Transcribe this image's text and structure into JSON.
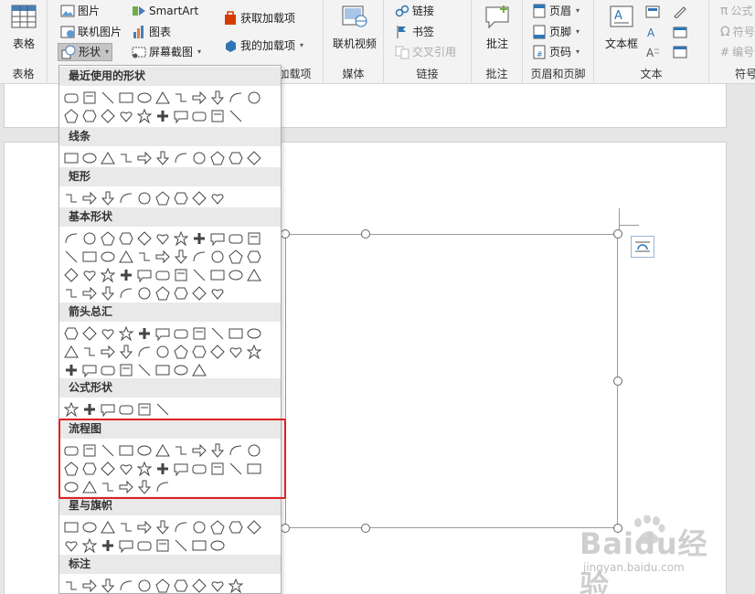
{
  "ribbon": {
    "tables": {
      "label": "表格",
      "group": "表格"
    },
    "illustrations": {
      "pictures": "图片",
      "online_pictures": "联机图片",
      "shapes": "形状",
      "smartart": "SmartArt",
      "chart": "图表",
      "screenshot": "屏幕截图"
    },
    "addins": {
      "get": "获取加载项",
      "mine": "我的加载项",
      "group": "加载项"
    },
    "media": {
      "online_video": "联机视频",
      "group": "媒体"
    },
    "links": {
      "link": "链接",
      "bookmark": "书签",
      "cross_ref": "交叉引用",
      "group": "链接"
    },
    "comments": {
      "comment": "批注",
      "group": "批注"
    },
    "header_footer": {
      "header": "页眉",
      "footer": "页脚",
      "page_number": "页码",
      "group": "页眉和页脚"
    },
    "text": {
      "textbox": "文本框",
      "group": "文本"
    },
    "symbols": {
      "equation": "公式",
      "symbol": "符号",
      "numbering": "编号",
      "group": "符号"
    }
  },
  "dropdown": {
    "sections": [
      {
        "title": "最近使用的形状",
        "count": 21
      },
      {
        "title": "线条",
        "count": 12
      },
      {
        "title": "矩形",
        "count": 9
      },
      {
        "title": "基本形状",
        "count": 42
      },
      {
        "title": "箭头总汇",
        "count": 30
      },
      {
        "title": "公式形状",
        "count": 6
      },
      {
        "title": "流程图",
        "count": 28
      },
      {
        "title": "星与旗帜",
        "count": 20
      },
      {
        "title": "标注",
        "count": 10
      }
    ]
  },
  "watermark": {
    "brand": "Baidu经验",
    "url": "jingyan.baidu.com"
  },
  "colors": {
    "highlight": "#e02020",
    "ribbon_bg": "#f3f3f3",
    "header_bg": "#e9e9e9"
  }
}
